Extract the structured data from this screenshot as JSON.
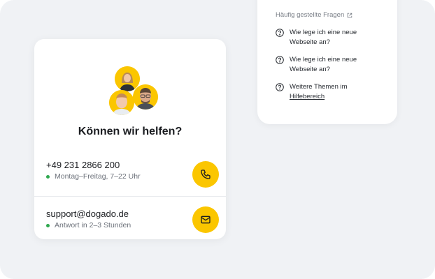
{
  "faq": {
    "heading": "Häufig gestellte Fragen",
    "items": [
      {
        "text": "Wie lege ich eine neue Webseite an?"
      },
      {
        "text": "Wie lege ich eine neue Webseite an?"
      }
    ],
    "more_text": "Weitere Themen im",
    "more_link": "Hilfebereich"
  },
  "contact": {
    "title": "Können wir helfen?",
    "phone": {
      "number": "+49 231 2866 200",
      "hours": "Montag–Freitag, 7–22 Uhr"
    },
    "email": {
      "address": "support@dogado.de",
      "response": "Antwort in 2–3 Stunden"
    }
  },
  "colors": {
    "accent": "#fbc600",
    "status": "#2fa84f"
  },
  "icons": {
    "external": "external-link-icon",
    "question": "question-circle-icon",
    "phone": "phone-icon",
    "mail": "mail-icon"
  }
}
